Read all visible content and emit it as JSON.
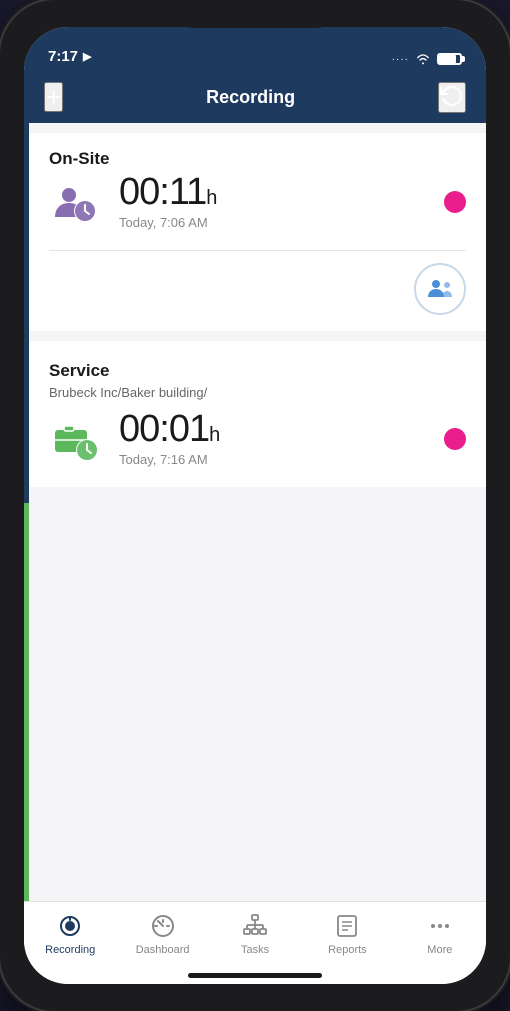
{
  "status": {
    "time": "7:17",
    "location_icon": "▶",
    "signal_dots": "····"
  },
  "header": {
    "add_label": "+",
    "title": "Recording",
    "refresh_label": "↻"
  },
  "cards": [
    {
      "id": "on-site",
      "label": "On-Site",
      "sublabel": "",
      "time": "00:11",
      "unit": "h",
      "timestamp": "Today, 7:06 AM",
      "icon_type": "user-clock",
      "icon_color": "#7b5ea7",
      "active": true
    },
    {
      "id": "service",
      "label": "Service",
      "sublabel": "Brubeck Inc/Baker building/",
      "time": "00:01",
      "unit": "h",
      "timestamp": "Today, 7:16 AM",
      "icon_type": "briefcase-clock",
      "icon_color": "#5cb85c",
      "active": true
    }
  ],
  "fab": {
    "tooltip": "Switch employee"
  },
  "bottom_nav": {
    "items": [
      {
        "id": "recording",
        "label": "Recording",
        "active": true
      },
      {
        "id": "dashboard",
        "label": "Dashboard",
        "active": false
      },
      {
        "id": "tasks",
        "label": "Tasks",
        "active": false
      },
      {
        "id": "reports",
        "label": "Reports",
        "active": false
      },
      {
        "id": "more",
        "label": "More",
        "active": false
      }
    ]
  }
}
